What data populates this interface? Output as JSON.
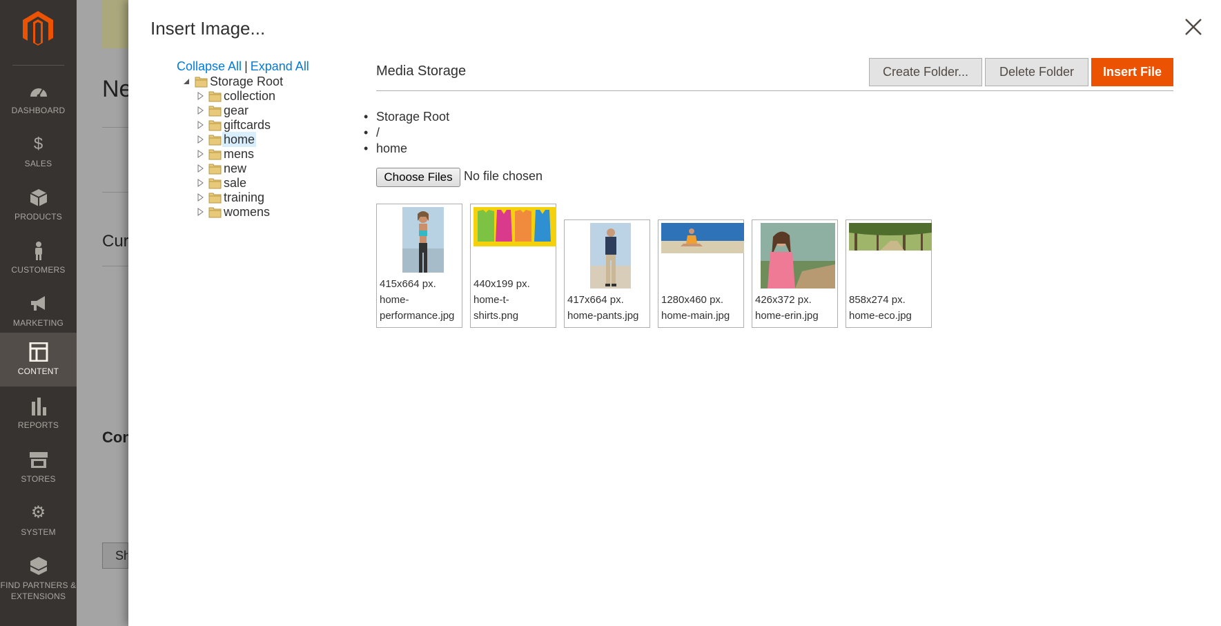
{
  "sidebar": {
    "items": [
      {
        "label": "DASHBOARD",
        "icon": "dashboard-icon"
      },
      {
        "label": "SALES",
        "icon": "dollar-icon"
      },
      {
        "label": "PRODUCTS",
        "icon": "box-icon"
      },
      {
        "label": "CUSTOMERS",
        "icon": "person-icon"
      },
      {
        "label": "MARKETING",
        "icon": "megaphone-icon"
      },
      {
        "label": "CONTENT",
        "icon": "layout-icon"
      },
      {
        "label": "REPORTS",
        "icon": "bar-chart-icon"
      },
      {
        "label": "STORES",
        "icon": "store-icon"
      },
      {
        "label": "SYSTEM",
        "icon": "gear-icon"
      },
      {
        "label": "FIND PARTNERS & EXTENSIONS",
        "icon": "cubes-icon"
      }
    ],
    "active": "CONTENT"
  },
  "background": {
    "title_fragment": "Ne",
    "section_fragment": "Cur",
    "section2_fragment": "Con",
    "button_fragment": "Sh"
  },
  "modal": {
    "title": "Insert Image...",
    "close_icon": "close-icon"
  },
  "tree": {
    "collapse_all": "Collapse All",
    "separator": "|",
    "expand_all": "Expand All",
    "root": "Storage Root",
    "folders": [
      "collection",
      "gear",
      "giftcards",
      "home",
      "mens",
      "new",
      "sale",
      "training",
      "womens"
    ],
    "selected": "home"
  },
  "content": {
    "section_title": "Media Storage",
    "buttons": {
      "create_folder": "Create Folder...",
      "delete_folder": "Delete Folder",
      "insert_file": "Insert File"
    },
    "breadcrumb": [
      "Storage Root",
      "/",
      "home"
    ],
    "file_input": {
      "button": "Choose Files",
      "status": "No file chosen"
    },
    "files": [
      {
        "dims": "415x664 px.",
        "name_line1": "home-",
        "name_line2": "performance.jpg"
      },
      {
        "dims": "440x199 px.",
        "name_line1": "home-t-",
        "name_line2": "shirts.png"
      },
      {
        "dims": "417x664 px.",
        "name_line1": "home-pants.jpg",
        "name_line2": ""
      },
      {
        "dims": "1280x460 px.",
        "name_line1": "home-main.jpg",
        "name_line2": ""
      },
      {
        "dims": "426x372 px.",
        "name_line1": "home-erin.jpg",
        "name_line2": ""
      },
      {
        "dims": "858x274 px.",
        "name_line1": "home-eco.jpg",
        "name_line2": ""
      }
    ]
  },
  "colors": {
    "sidebar_bg": "#373330",
    "accent": "#eb5202",
    "link": "#007bdb"
  }
}
